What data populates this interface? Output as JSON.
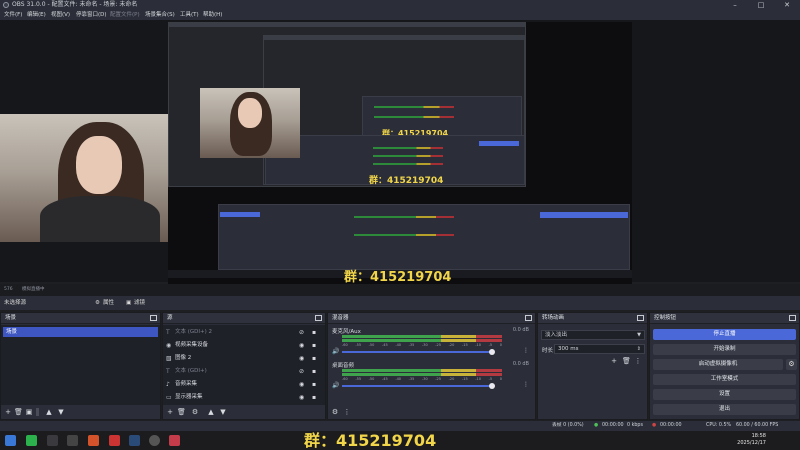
{
  "window": {
    "title": "OBS 31.0.0 - 配置文件: 未命名 - 场景: 未命名"
  },
  "menu": [
    {
      "label": "文件(F)",
      "enabled": true
    },
    {
      "label": "编辑(E)",
      "enabled": true
    },
    {
      "label": "视图(V)",
      "enabled": true
    },
    {
      "label": "停靠窗口(D)",
      "enabled": true
    },
    {
      "label": "配置文件(P)",
      "enabled": false
    },
    {
      "label": "场景集合(S)",
      "enabled": true
    },
    {
      "label": "工具(T)",
      "enabled": true
    },
    {
      "label": "帮助(H)",
      "enabled": true
    }
  ],
  "preview": {
    "overlay_text": "群：415219704",
    "nested_overlay_text": "群：415219704",
    "small_overlay_text": "群：415219704"
  },
  "subbar": {
    "fps": "576",
    "mode": "模拟直播中"
  },
  "scenebar": {
    "no_source": "未选择源",
    "properties_label": "属性",
    "filters_label": "滤镜"
  },
  "scenes": {
    "title": "场景",
    "items": [
      {
        "label": "场景"
      }
    ]
  },
  "sources": {
    "title": "源",
    "items": [
      {
        "label": "文本 (GDI+) 2",
        "icon": "text-icon",
        "visible": false
      },
      {
        "label": "视频采集设备",
        "icon": "camera-icon",
        "visible": true
      },
      {
        "label": "图像 2",
        "icon": "image-icon",
        "visible": true
      },
      {
        "label": "文本 (GDI+)",
        "icon": "text-icon",
        "visible": false
      },
      {
        "label": "音频采集",
        "icon": "audio-icon",
        "visible": true
      },
      {
        "label": "显示器采集",
        "icon": "monitor-icon",
        "visible": true
      }
    ]
  },
  "mixer": {
    "title": "混音器",
    "channels": [
      {
        "name": "麦克风/Aux",
        "db": "0.0 dB"
      },
      {
        "name": "桌面音频",
        "db": "0.0 dB"
      }
    ],
    "ticks": [
      "-60",
      "-55",
      "-50",
      "-45",
      "-40",
      "-35",
      "-30",
      "-25",
      "-20",
      "-15",
      "-10",
      "-5",
      "0"
    ]
  },
  "transitions": {
    "title": "转场动画",
    "selected": "淡入淡出",
    "duration_label": "时长",
    "duration_value": "300 ms"
  },
  "controls": {
    "title": "控制按钮",
    "buttons": [
      {
        "label": "停止直播",
        "active": true
      },
      {
        "label": "开始录制",
        "active": false
      },
      {
        "label": "启动虚拟摄像机",
        "active": false
      },
      {
        "label": "工作室模式",
        "active": false
      },
      {
        "label": "设置",
        "active": false
      },
      {
        "label": "退出",
        "active": false
      }
    ]
  },
  "status": {
    "dropped": "丢帧 0 (0.0%)",
    "live_time": "00:00:00",
    "bitrate": "0 kbps",
    "rec_time": "00:00:00",
    "cpu": "CPU: 0.5%",
    "fps": "60.00 / 60.00 FPS"
  },
  "taskbar": {
    "time": "18:58",
    "date": "2025/12/17"
  },
  "colors": {
    "accent": "#4a68d8",
    "overlay_yellow": "#f2d64a",
    "panel": "#2b2e38"
  }
}
